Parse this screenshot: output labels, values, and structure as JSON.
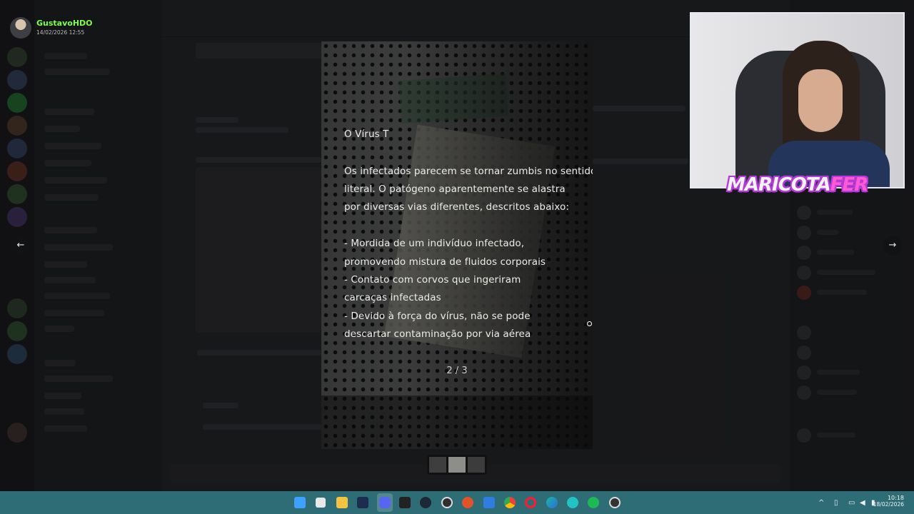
{
  "header": {
    "username": "GustavoHDO",
    "date": "14/02/2026 12:55",
    "avatar_icon": "user-avatar"
  },
  "viewer": {
    "title": "O Vírus T",
    "paragraph": [
      "Os infectados parecem se tornar zumbis no sentido",
      "literal. O patógeno aparentemente se alastra",
      "por diversas vias diferentes, descritos abaixo:"
    ],
    "items": [
      " - Mordida de um indivíduo infectado,",
      "promovendo mistura de fluidos corporais",
      " - Contato com corvos que ingeriram",
      "carcaças infectadas",
      " - Devido à força do vírus, não se pode",
      "descartar contaminação por via aérea"
    ],
    "page_indicator": "2 / 3",
    "prev_icon": "arrow-left-icon",
    "next_icon": "arrow-right-icon",
    "prev_glyph": "←",
    "next_glyph": "→"
  },
  "overlay": {
    "logo_part1": "MARICOTA",
    "logo_part2": "FER"
  },
  "taskbar": {
    "time": "10:18",
    "date": "18/02/2026",
    "icons": [
      "windows-start-icon",
      "task-view-icon",
      "file-explorer-icon",
      "app-icon",
      "discord-icon",
      "epic-games-icon",
      "steam-icon",
      "obs-icon",
      "app-icon",
      "app-icon",
      "chrome-icon",
      "opera-icon",
      "edge-icon",
      "app-icon",
      "spotify-icon",
      "app-icon"
    ]
  }
}
